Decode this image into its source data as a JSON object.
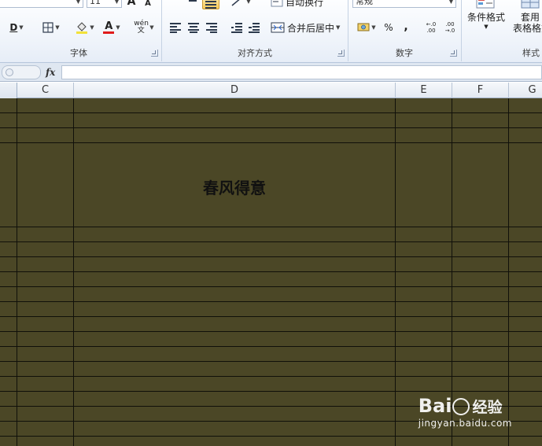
{
  "ribbon": {
    "font_size_value": "11",
    "font_group_label": "字体",
    "alignment_group_label": "对齐方式",
    "number_group_label": "数字",
    "styles_group_label": "样式",
    "wrap_text_label": "自动换行",
    "merge_center_label": "合并后居中",
    "number_format_value": "常规",
    "conditional_format_label": "条件格式",
    "table_format_label_1": "套用",
    "table_format_label_2": "表格格式",
    "percent_label": "%",
    "comma_label": ",",
    "increase_decimal_label": "←.0 .00",
    "decrease_decimal_label": ".00 →.0",
    "phonetic_label": "wén 文",
    "font_grow_label": "A",
    "font_shrink_label": "A",
    "underline_label": "D",
    "font_color_label": "A"
  },
  "formula_bar": {
    "fx_label": "fx",
    "formula_value": ""
  },
  "columns": [
    "C",
    "D",
    "E",
    "F",
    "G"
  ],
  "sheet": {
    "cell_text": "春风得意",
    "fill_color": "#4b4726",
    "gridline_color": "#10100a"
  },
  "watermark": {
    "logo_left": "Bai",
    "logo_right": "经验",
    "url": "jingyan.baidu.com"
  }
}
